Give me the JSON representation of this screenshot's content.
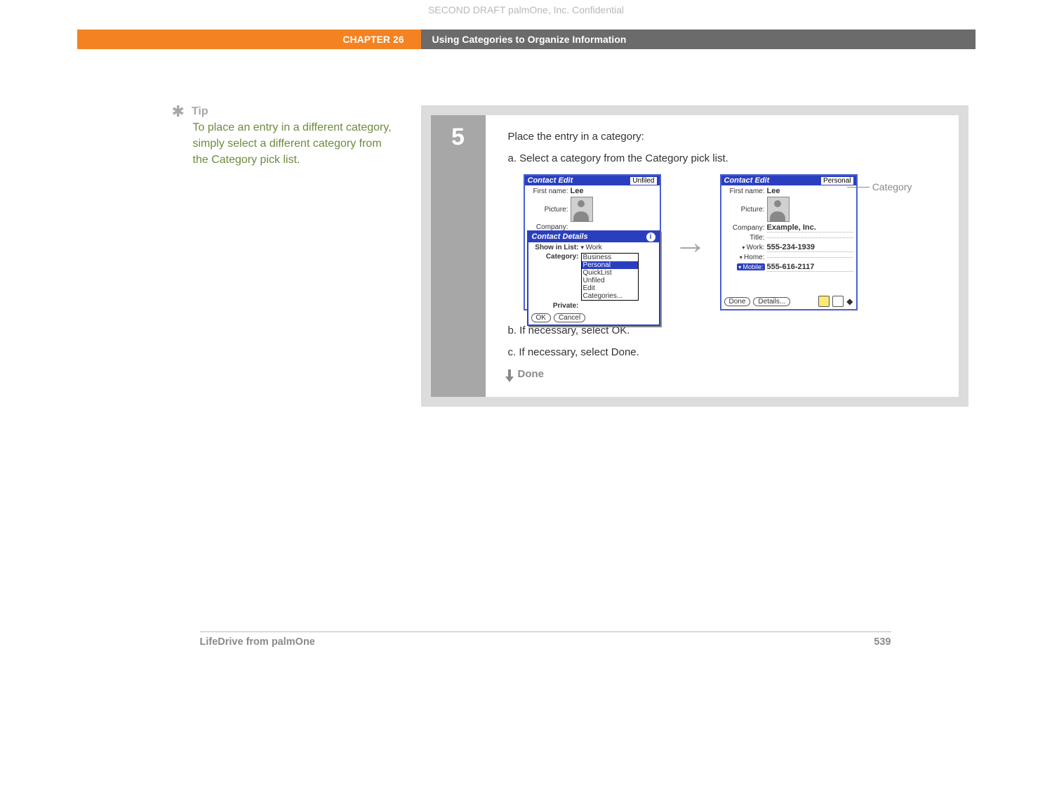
{
  "watermark": "SECOND DRAFT palmOne, Inc.  Confidential",
  "header": {
    "chapter": "CHAPTER 26",
    "title": "Using Categories to Organize Information"
  },
  "tip": {
    "label": "Tip",
    "body": "To place an entry in a different category, simply select a different category from the Category pick list."
  },
  "step": {
    "number": "5",
    "intro": "Place the entry in a category:",
    "a": "a.  Select a category from the Category pick list.",
    "b": "b.  If necessary, select OK.",
    "c": "c.  If necessary, select Done.",
    "done": "Done"
  },
  "callout": "Category",
  "screen1": {
    "title": "Contact Edit",
    "category": "Unfiled",
    "firstname_label": "First name:",
    "firstname_value": "Lee",
    "picture_label": "Picture:",
    "company_label": "Company:",
    "details": {
      "title": "Contact Details",
      "showinlist_label": "Show in List:",
      "showinlist_value": "Work",
      "category_label": "Category:",
      "private_label": "Private:",
      "options": [
        "Business",
        "Personal",
        "QuickList",
        "Unfiled",
        "Edit Categories..."
      ],
      "ok": "OK",
      "cancel": "Cancel"
    }
  },
  "screen2": {
    "title": "Contact Edit",
    "category": "Personal",
    "firstname_label": "First name:",
    "firstname_value": "Lee",
    "picture_label": "Picture:",
    "company_label": "Company:",
    "company_value": "Example, Inc.",
    "title_label": "Title:",
    "work_label": "Work:",
    "work_value": "555-234-1939",
    "home_label": "Home:",
    "mobile_label": "Mobile:",
    "mobile_value": "555-616-2117",
    "done_btn": "Done",
    "details_btn": "Details..."
  },
  "footer": {
    "product": "LifeDrive from palmOne",
    "page": "539"
  }
}
